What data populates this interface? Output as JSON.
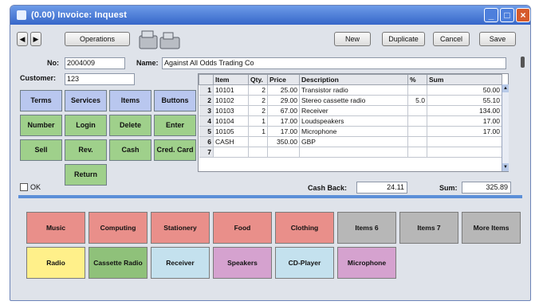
{
  "window": {
    "title": "(0.00) Invoice: Inquest",
    "colors": {
      "titlebar": "#3667c9",
      "close": "#d65a2b",
      "divider": "#5b8fd8"
    }
  },
  "toolbar": {
    "prev_label": "◀",
    "next_label": "▶",
    "operations_label": "Operations",
    "new_label": "New",
    "duplicate_label": "Duplicate",
    "cancel_label": "Cancel",
    "save_label": "Save"
  },
  "form": {
    "no_label": "No:",
    "no_value": "2004009",
    "name_label": "Name:",
    "name_value": "Against All Odds Trading Co",
    "customer_label": "Customer:",
    "customer_value": "123"
  },
  "function_buttons": [
    "Terms",
    "Services",
    "Items",
    "Buttons",
    "Number",
    "Login",
    "Delete",
    "Enter",
    "Sell",
    "Rev.",
    "Cash",
    "Cred. Card",
    "Return"
  ],
  "grid": {
    "columns": [
      "",
      "Item",
      "Qty.",
      "Price",
      "Description",
      "%",
      "Sum"
    ],
    "rows": [
      [
        "1",
        "10101",
        "2",
        "25.00",
        "Transistor radio",
        "",
        "50.00"
      ],
      [
        "2",
        "10102",
        "2",
        "29.00",
        "Stereo cassette radio",
        "5.0",
        "55.10"
      ],
      [
        "3",
        "10103",
        "2",
        "67.00",
        "Receiver",
        "",
        "134.00"
      ],
      [
        "4",
        "10104",
        "1",
        "17.00",
        "Loudspeakers",
        "",
        "17.00"
      ],
      [
        "5",
        "10105",
        "1",
        "17.00",
        "Microphone",
        "",
        "17.00"
      ],
      [
        "6",
        "CASH",
        "",
        "350.00",
        "GBP",
        "",
        ""
      ],
      [
        "7",
        "",
        "",
        "",
        "",
        "",
        ""
      ]
    ]
  },
  "ok_label": "OK",
  "totals": {
    "cash_back_label": "Cash Back:",
    "cash_back_value": "24.11",
    "sum_label": "Sum:",
    "sum_value": "325.89"
  },
  "categories": [
    {
      "label": "Music",
      "color": "#e98f8a"
    },
    {
      "label": "Computing",
      "color": "#e98f8a"
    },
    {
      "label": "Stationery",
      "color": "#e98f8a"
    },
    {
      "label": "Food",
      "color": "#e98f8a"
    },
    {
      "label": "Clothing",
      "color": "#e98f8a"
    },
    {
      "label": "Items 6",
      "color": "#b7b7b7"
    },
    {
      "label": "Items 7",
      "color": "#b7b7b7"
    },
    {
      "label": "More Items",
      "color": "#b7b7b7"
    },
    {
      "label": "Radio",
      "color": "#fff08a"
    },
    {
      "label": "Cassette Radio",
      "color": "#8fc17a"
    },
    {
      "label": "Receiver",
      "color": "#c4e1ee"
    },
    {
      "label": "Speakers",
      "color": "#d5a2cf"
    },
    {
      "label": "CD-Player",
      "color": "#c4e1ee"
    },
    {
      "label": "Microphone",
      "color": "#d5a2cf"
    }
  ]
}
